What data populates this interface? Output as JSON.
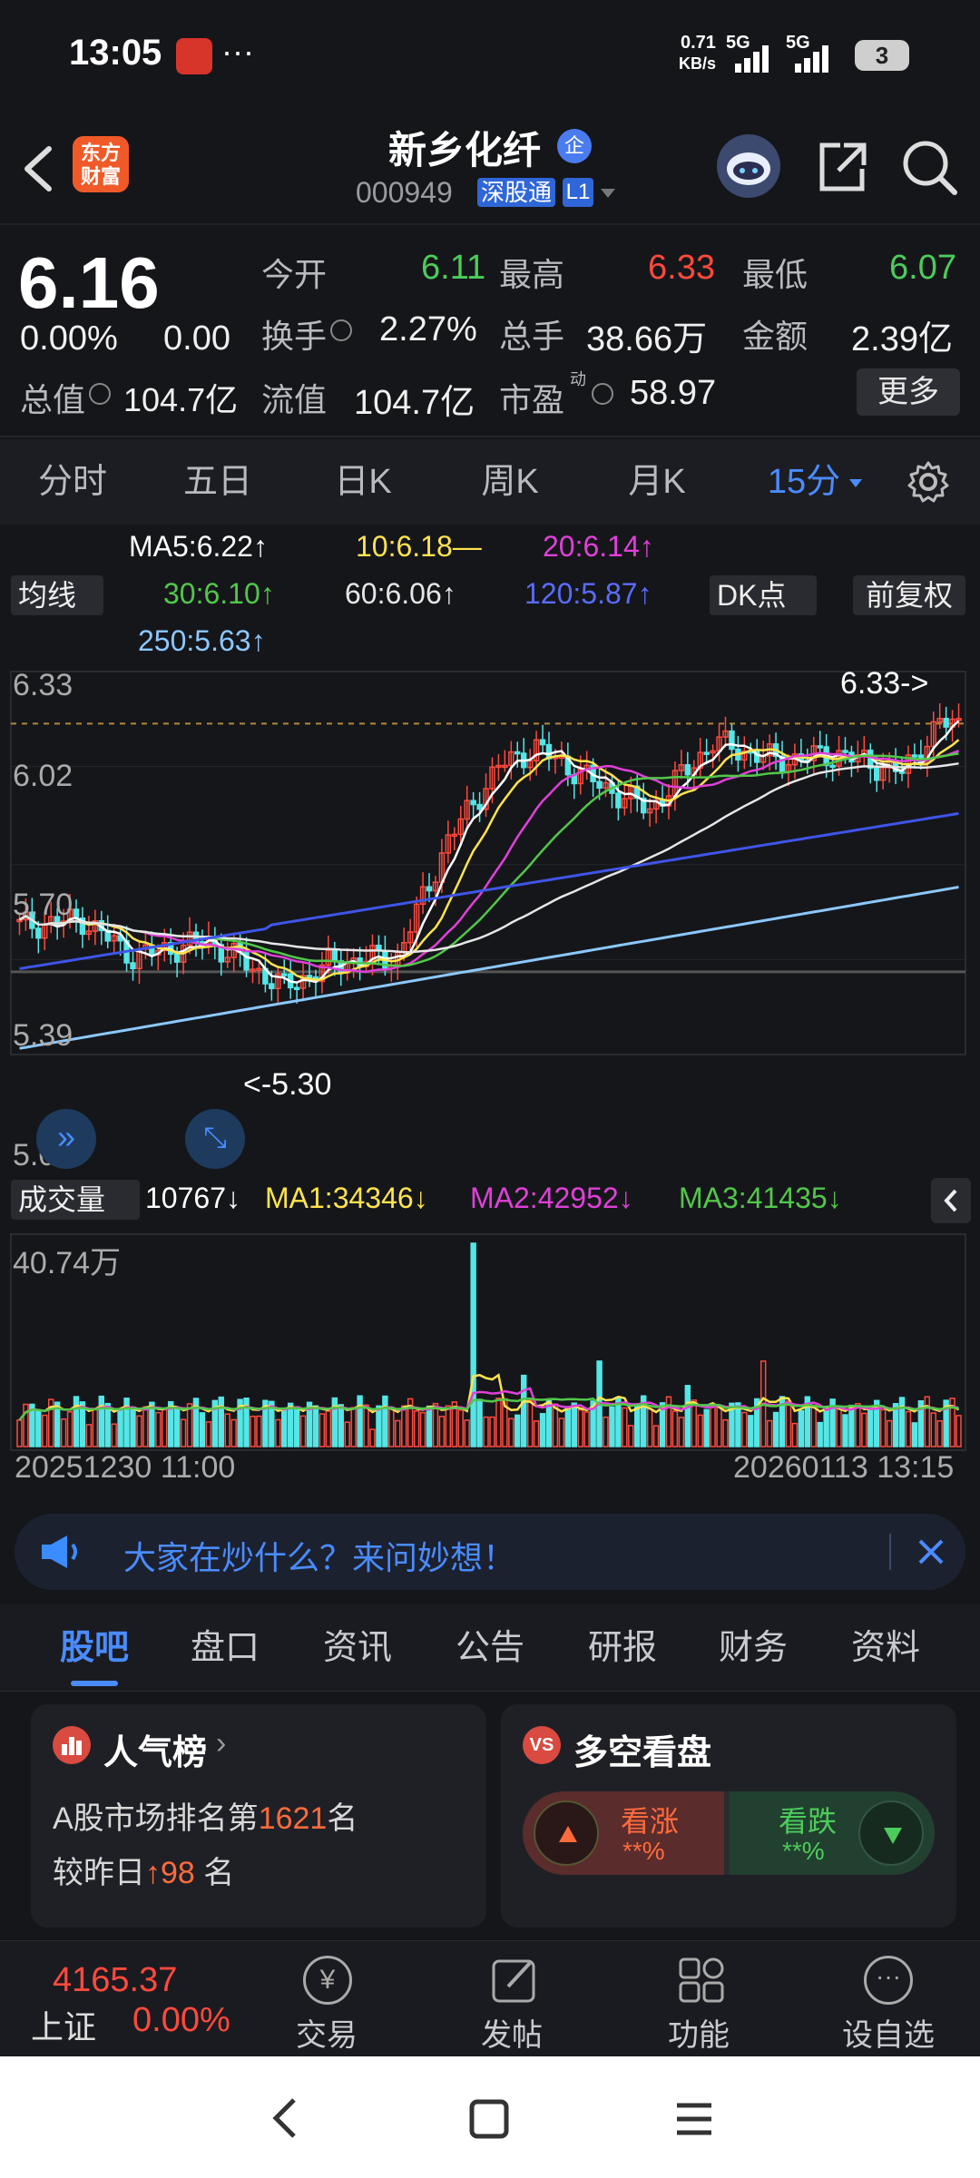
{
  "status": {
    "time": "13:05",
    "more": "···",
    "net_speed": "0.71",
    "net_unit": "KB/s",
    "signal1": "5G",
    "signal2": "5G",
    "battery": "3"
  },
  "header": {
    "logo_line1": "东方",
    "logo_line2": "财富",
    "stock_name": "新乡化纤",
    "badge": "企",
    "code": "000949",
    "market_tag": "深股通",
    "level_tag": "L1"
  },
  "quote": {
    "price": "6.16",
    "change_pct": "0.00%",
    "change": "0.00",
    "open_label": "今开",
    "open": "6.11",
    "high_label": "最高",
    "high": "6.33",
    "low_label": "最低",
    "low": "6.07",
    "turnover_label": "换手",
    "turnover": "2.27%",
    "volume_label": "总手",
    "volume": "38.66万",
    "amount_label": "金额",
    "amount": "2.39亿",
    "mcap_label": "总值",
    "mcap": "104.7亿",
    "float_label": "流值",
    "float_cap": "104.7亿",
    "pe_label": "市盈",
    "pe_sup": "动",
    "pe": "58.97",
    "more_button": "更多"
  },
  "period_tabs": [
    "分时",
    "五日",
    "日K",
    "周K",
    "月K",
    "15分"
  ],
  "ma_legend": {
    "ma5": "MA5:6.22↑",
    "ma10": "10:6.18—",
    "ma20": "20:6.14↑",
    "ma30": "30:6.10↑",
    "ma60": "60:6.06↑",
    "ma120": "120:5.87↑",
    "ma250": "250:5.63↑",
    "junxian": "均线",
    "dk": "DK点",
    "fq": "前复权"
  },
  "price_axis": [
    "6.33",
    "6.02",
    "5.70",
    "5.39",
    "5.08"
  ],
  "price_annotations": {
    "high_mark": "6.33->",
    "low_mark": "<-5.30"
  },
  "volume_legend": {
    "label": "成交量",
    "vol": "10767↓",
    "ma1": "MA1:34346↓",
    "ma2": "MA2:42952↓",
    "ma3": "MA3:41435↓",
    "max": "40.74万"
  },
  "time_axis": {
    "start": "20251230 11:00",
    "end": "20260113 13:15"
  },
  "banner": {
    "text": "大家在炒什么？来问妙想！"
  },
  "sub_tabs": [
    "股吧",
    "盘口",
    "资讯",
    "公告",
    "研报",
    "财务",
    "资料"
  ],
  "card_popularity": {
    "title": "人气榜",
    "line1_prefix": "A股市场排名第",
    "rank": "1621",
    "line1_suffix": "名",
    "line2_prefix": "较昨日",
    "delta": "98",
    "line2_suffix": "名"
  },
  "card_vs": {
    "title": "多空看盘",
    "bull": "看涨",
    "bull_pct": "**%",
    "bear": "看跌",
    "bear_pct": "**%"
  },
  "bottom": {
    "index_value": "4165.37",
    "index_name": "上证",
    "index_pct": "0.00%",
    "trade": "交易",
    "post": "发帖",
    "func": "功能",
    "watch": "设自选"
  },
  "colors": {
    "red": "#ff4a3d",
    "green": "#4ccc5a",
    "ma5": "#ffffff",
    "ma10": "#ffe44d",
    "ma20": "#e040d8",
    "ma30": "#52c74a",
    "ma60": "#e6e6e6",
    "ma120": "#3f55e8",
    "ma250": "#8cc8ff",
    "accent": "#3a8cff"
  },
  "chart_data": {
    "type": "candlestick",
    "price_ylim": [
      5.08,
      6.33
    ],
    "price_ticks": [
      6.33,
      6.02,
      5.7,
      5.39,
      5.08
    ],
    "high": 6.33,
    "low": 5.3,
    "ma_last": {
      "MA5": 6.22,
      "MA10": 6.18,
      "MA20": 6.14,
      "MA30": 6.1,
      "MA60": 6.06,
      "MA120": 5.87,
      "MA250": 5.63
    },
    "volume_max": "40.74万",
    "volume_last": 10767,
    "vol_ma": {
      "MA1": 34346,
      "MA2": 42952,
      "MA3": 41435
    }
  }
}
